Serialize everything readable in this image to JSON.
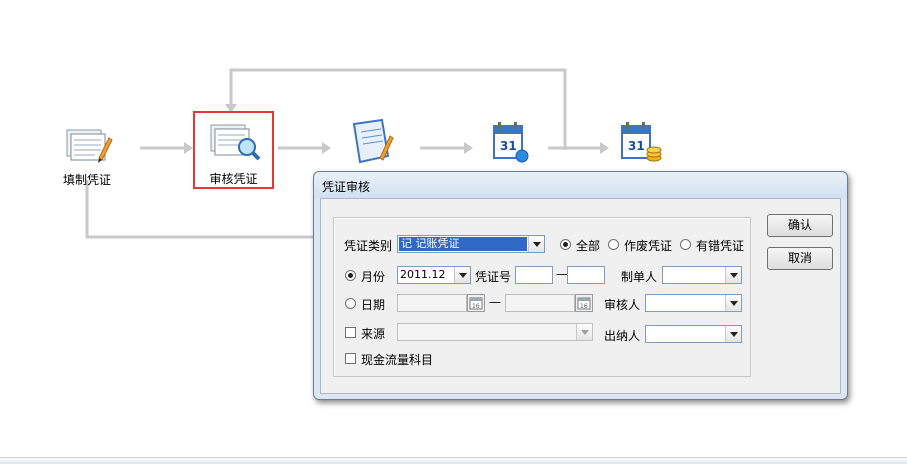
{
  "workflow": {
    "nodes": [
      {
        "label": "填制凭证",
        "icon": "voucher-entry-icon"
      },
      {
        "label": "审核凭证",
        "icon": "voucher-audit-icon"
      },
      {
        "label": "",
        "icon": "voucher-post-icon"
      },
      {
        "label": "",
        "icon": "calendar-icon"
      },
      {
        "label": "",
        "icon": "calendar-money-icon"
      }
    ],
    "highlight_color": "#e53935"
  },
  "dialog": {
    "title": "凭证审核",
    "confirm_label": "确认",
    "cancel_label": "取消",
    "voucher_type_label": "凭证类别",
    "voucher_type_value": "记    记账凭证",
    "scope_all_label": "全部",
    "scope_void_label": "作废凭证",
    "scope_error_label": "有错凭证",
    "month_label": "月份",
    "month_value": "2011.12",
    "voucher_no_label": "凭证号",
    "voucher_no_from": "",
    "voucher_no_to": "",
    "range_dash": "—",
    "maker_label": "制单人",
    "maker_value": "",
    "date_label": "日期",
    "date_from": "",
    "date_to": "",
    "auditor_label": "审核人",
    "auditor_value": "",
    "source_label": "来源",
    "source_value": "",
    "cashier_label": "出纳人",
    "cashier_value": "",
    "cashflow_label": "现金流量科目"
  }
}
